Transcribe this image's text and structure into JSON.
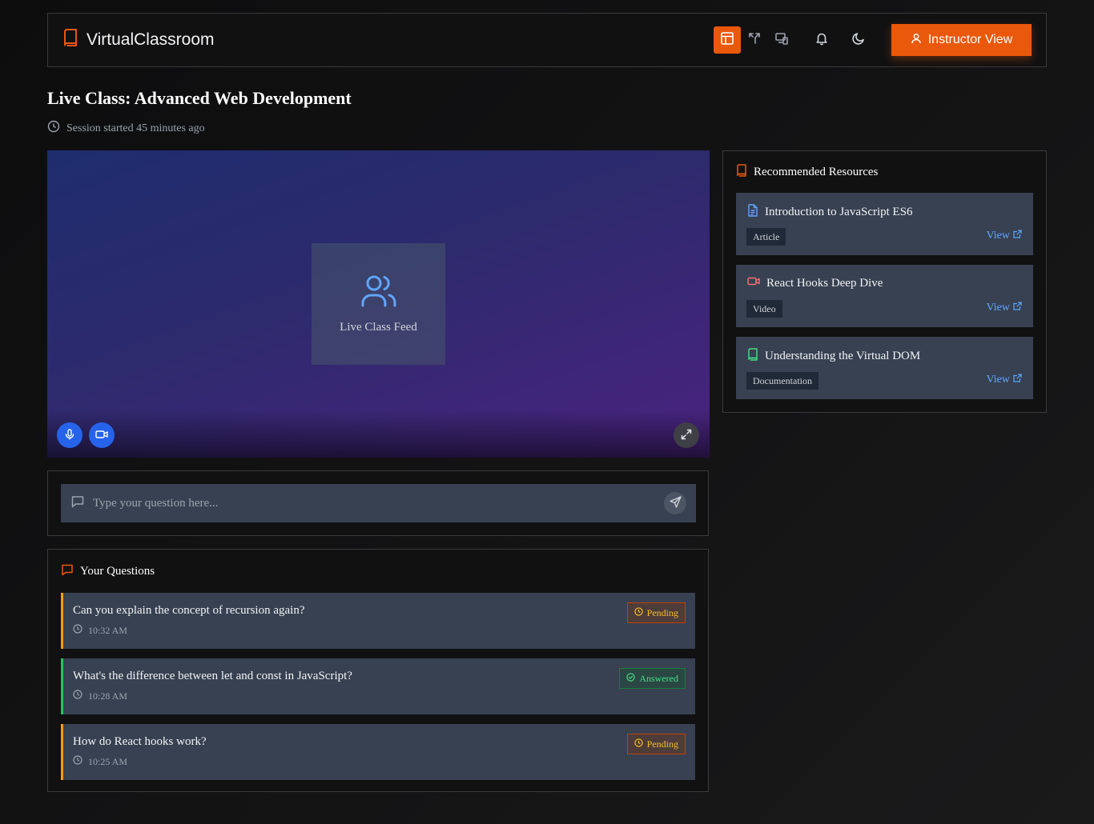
{
  "header": {
    "brand": "VirtualClassroom",
    "instructor_button": "Instructor View",
    "icons": [
      "layout-icon",
      "split-icon",
      "devices-icon",
      "bell-icon",
      "moon-icon"
    ]
  },
  "page": {
    "title": "Live Class: Advanced Web Development",
    "session_status": "Session started 45 minutes ago"
  },
  "video": {
    "feed_label": "Live Class Feed"
  },
  "question_input": {
    "placeholder": "Type your question here..."
  },
  "your_questions": {
    "heading": "Your Questions",
    "items": [
      {
        "text": "Can you explain the concept of recursion again?",
        "time": "10:32 AM",
        "status": "Pending"
      },
      {
        "text": "What's the difference between let and const in JavaScript?",
        "time": "10:28 AM",
        "status": "Answered"
      },
      {
        "text": "How do React hooks work?",
        "time": "10:25 AM",
        "status": "Pending"
      }
    ]
  },
  "resources": {
    "heading": "Recommended Resources",
    "items": [
      {
        "title": "Introduction to JavaScript ES6",
        "type": "Article",
        "action": "View",
        "icon": "document-icon"
      },
      {
        "title": "React Hooks Deep Dive",
        "type": "Video",
        "action": "View",
        "icon": "video-icon"
      },
      {
        "title": "Understanding the Virtual DOM",
        "type": "Documentation",
        "action": "View",
        "icon": "book-icon"
      }
    ]
  },
  "colors": {
    "accent": "#ea580c",
    "pending": "#fbbf24",
    "answered": "#4ade80",
    "link": "#60a5fa",
    "control_blue": "#2563eb"
  }
}
